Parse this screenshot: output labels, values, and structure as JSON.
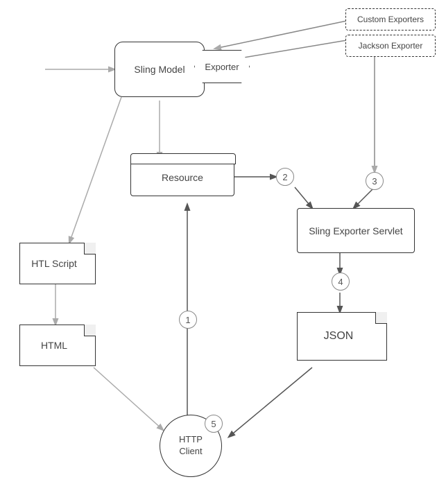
{
  "nodes": {
    "sling_model": {
      "label": "Sling Model"
    },
    "exporter": {
      "label": "Exporter"
    },
    "custom_exporters": {
      "label": "Custom Exporters"
    },
    "jackson_exporter": {
      "label": "Jackson Exporter"
    },
    "resource": {
      "label": "Resource"
    },
    "htl_script": {
      "label": "HTL Script"
    },
    "html": {
      "label": "HTML"
    },
    "sling_exporter_servlet": {
      "label": "Sling Exporter Servlet"
    },
    "json": {
      "label": "JSON"
    },
    "http_client": {
      "label": "HTTP\nClient"
    }
  },
  "badges": {
    "b1": "1",
    "b2": "2",
    "b3": "3",
    "b4": "4",
    "b5": "5"
  }
}
